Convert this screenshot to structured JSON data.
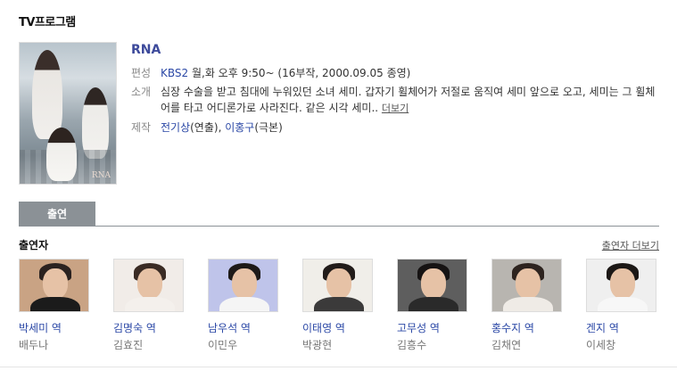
{
  "section_title": "TV프로그램",
  "program": {
    "title": "RNA",
    "poster_logo": "RNA",
    "schedule": {
      "label": "편성",
      "channel": "KBS2",
      "text": " 월,화 오후 9:50~ (16부작, 2000.09.05 종영)"
    },
    "summary": {
      "label": "소개",
      "text": "심장 수술을 받고 침대에 누워있던 소녀 세미. 갑자기 휠체어가 저절로 움직여 세미 앞으로 오고, 세미는 그 휠체어를 타고 어디론가로 사라진다. 같은 시각 세미.. ",
      "more": "더보기"
    },
    "staff": {
      "label": "제작",
      "director": "전기상",
      "director_role": "(연출), ",
      "writer": "이홍구",
      "writer_role": "(극본)"
    }
  },
  "tabs": [
    {
      "label": "출연"
    }
  ],
  "cast_section": {
    "title": "출연자",
    "more": "출연자 더보기",
    "items": [
      {
        "role": "박세미 역",
        "actor": "배두나",
        "bg": "#c9a384",
        "hair": "#2a2220",
        "cloth": "#1b1b1b"
      },
      {
        "role": "김명숙 역",
        "actor": "김효진",
        "bg": "#f1ece8",
        "hair": "#3a2b24",
        "cloth": "#f4f0ec"
      },
      {
        "role": "남우석 역",
        "actor": "이민우",
        "bg": "#bfc4ea",
        "hair": "#1e1a18",
        "cloth": "#f5f5f5"
      },
      {
        "role": "이태영 역",
        "actor": "박광현",
        "bg": "#f0eee9",
        "hair": "#221c1a",
        "cloth": "#3b3a3a"
      },
      {
        "role": "고무성 역",
        "actor": "김흥수",
        "bg": "#5e5e5e",
        "hair": "#161313",
        "cloth": "#2a2a2a"
      },
      {
        "role": "홍수지 역",
        "actor": "김채연",
        "bg": "#b8b5b0",
        "hair": "#2e241f",
        "cloth": "#efebe6"
      },
      {
        "role": "겐지 역",
        "actor": "이세창",
        "bg": "#efefef",
        "hair": "#1c1816",
        "cloth": "#f7f7f7"
      }
    ]
  }
}
